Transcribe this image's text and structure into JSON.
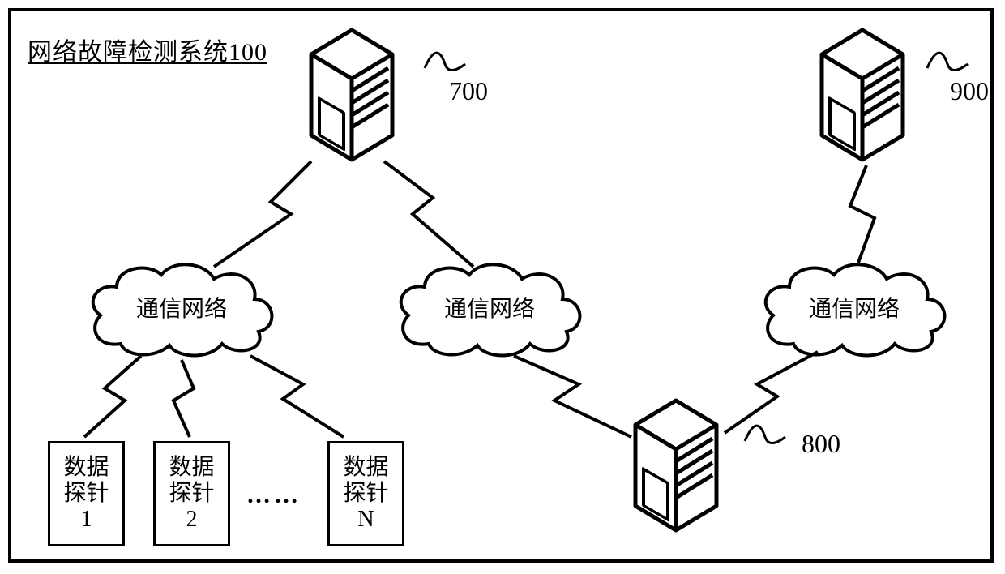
{
  "system_title": "网络故障检测系统100",
  "clouds": {
    "c1": "通信网络",
    "c2": "通信网络",
    "c3": "通信网络"
  },
  "probes": {
    "p1_line1": "数据",
    "p1_line2": "探针",
    "p1_line3": "1",
    "p2_line1": "数据",
    "p2_line2": "探针",
    "p2_line3": "2",
    "pn_line1": "数据",
    "pn_line2": "探针",
    "pn_line3": "N"
  },
  "dots": "……",
  "labels": {
    "l700": "700",
    "l800": "800",
    "l900": "900"
  }
}
